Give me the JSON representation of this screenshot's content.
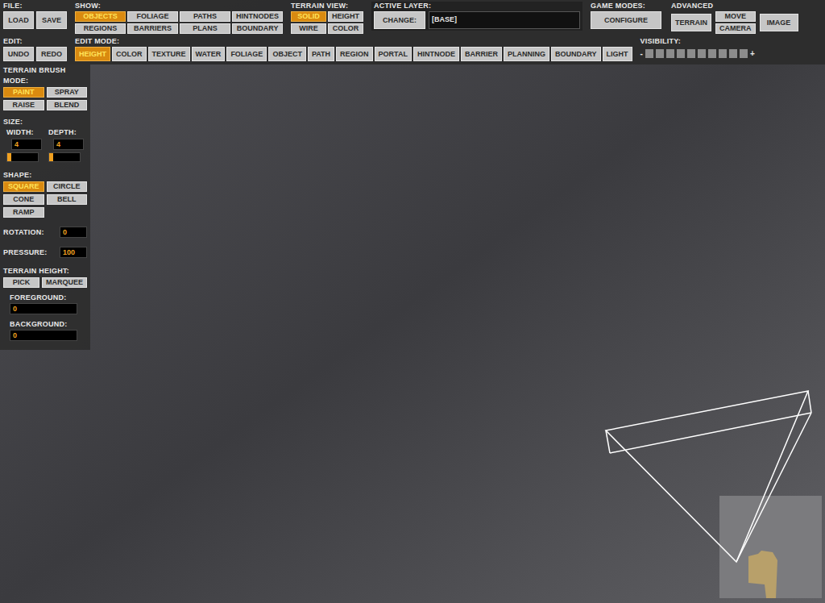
{
  "file": {
    "label": "FILE:",
    "buttons": [
      "LOAD",
      "SAVE"
    ]
  },
  "show": {
    "label": "SHOW:",
    "items": [
      {
        "label": "OBJECTS",
        "selected": true
      },
      {
        "label": "FOLIAGE",
        "selected": false
      },
      {
        "label": "PATHS",
        "selected": false
      },
      {
        "label": "HINTNODES",
        "selected": false
      },
      {
        "label": "REGIONS",
        "selected": false
      },
      {
        "label": "BARRIERS",
        "selected": false
      },
      {
        "label": "PLANS",
        "selected": false
      },
      {
        "label": "BOUNDARY",
        "selected": false
      }
    ]
  },
  "terrain_view": {
    "label": "TERRAIN VIEW:",
    "items": [
      {
        "label": "SOLID",
        "selected": true
      },
      {
        "label": "HEIGHT",
        "selected": false
      },
      {
        "label": "WIRE",
        "selected": false
      },
      {
        "label": "COLOR",
        "selected": false
      }
    ]
  },
  "active_layer": {
    "label": "ACTIVE LAYER:",
    "button": "CHANGE:",
    "value": "[BASE]"
  },
  "game_modes": {
    "label": "GAME MODES:",
    "buttons": [
      "CONFIGURE"
    ]
  },
  "advanced": {
    "label": "ADVANCED",
    "buttons": [
      "TERRAIN",
      "MOVE",
      "CAMERA",
      "IMAGE"
    ]
  },
  "edit": {
    "label": "EDIT:",
    "buttons": [
      "UNDO",
      "REDO"
    ]
  },
  "edit_mode": {
    "label": "EDIT MODE:",
    "items": [
      {
        "label": "HEIGHT",
        "selected": true
      },
      {
        "label": "COLOR",
        "selected": false
      },
      {
        "label": "TEXTURE",
        "selected": false
      },
      {
        "label": "WATER",
        "selected": false
      },
      {
        "label": "FOLIAGE",
        "selected": false
      },
      {
        "label": "OBJECT",
        "selected": false
      },
      {
        "label": "PATH",
        "selected": false
      },
      {
        "label": "REGION",
        "selected": false
      },
      {
        "label": "PORTAL",
        "selected": false
      },
      {
        "label": "HINTNODE",
        "selected": false
      },
      {
        "label": "BARRIER",
        "selected": false
      },
      {
        "label": "PLANNING",
        "selected": false
      },
      {
        "label": "BOUNDARY",
        "selected": false
      },
      {
        "label": "LIGHT",
        "selected": false
      }
    ]
  },
  "visibility": {
    "label": "VISIBILITY:",
    "minus": "-",
    "plus": "+",
    "level": 0
  },
  "brush": {
    "title": "TERRAIN BRUSH",
    "mode_label": "MODE:",
    "modes": [
      {
        "label": "PAINT",
        "selected": true
      },
      {
        "label": "SPRAY",
        "selected": false
      },
      {
        "label": "RAISE",
        "selected": false
      },
      {
        "label": "BLEND",
        "selected": false
      }
    ],
    "size_label": "SIZE:",
    "width": {
      "label": "WIDTH:",
      "value": "4",
      "level": 0
    },
    "depth": {
      "label": "DEPTH:",
      "value": "4",
      "level": 0
    },
    "shape_label": "SHAPE:",
    "shapes": [
      {
        "label": "SQUARE",
        "selected": true
      },
      {
        "label": "CIRCLE",
        "selected": false
      },
      {
        "label": "CONE",
        "selected": false
      },
      {
        "label": "BELL",
        "selected": false
      },
      {
        "label": "RAMP",
        "selected": false
      }
    ],
    "rotation": {
      "label": "ROTATION:",
      "value": "0"
    },
    "pressure": {
      "label": "PRESSURE:",
      "value": "100"
    },
    "height_label": "TERRAIN HEIGHT:",
    "height_buttons": [
      "PICK",
      "MARQUEE"
    ],
    "foreground": {
      "label": "FOREGROUND:",
      "value": "0"
    },
    "background": {
      "label": "BACKGROUND:",
      "value": "0"
    }
  }
}
